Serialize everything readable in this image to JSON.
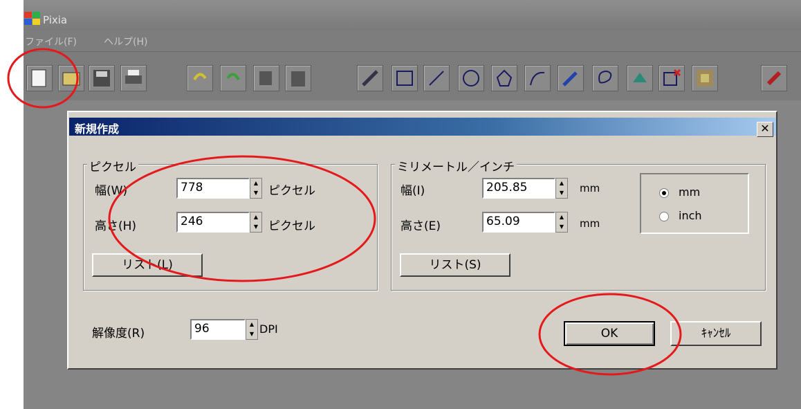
{
  "app": {
    "title": "Pixia",
    "menu": [
      "ファイル(F)",
      "ヘルプ(H)"
    ],
    "toolbar_icons": [
      "new-file-icon",
      "open-icon",
      "save-icon",
      "print-icon",
      "undo-icon",
      "redo-icon",
      "copy-icon",
      "paste-icon",
      "pen-icon",
      "rectangle-icon",
      "line-icon",
      "ellipse-icon",
      "polygon-icon",
      "curve-icon",
      "spray-icon",
      "lasso-icon",
      "fill-icon",
      "cross-select-icon",
      "pattern-icon",
      "brush-icon"
    ]
  },
  "dialog": {
    "title": "新規作成",
    "close_label": "✕",
    "pixel_group": {
      "label": "ピクセル",
      "width_label": "幅(W)",
      "width_value": "778",
      "width_unit": "ピクセル",
      "height_label": "高さ(H)",
      "height_value": "246",
      "height_unit": "ピクセル",
      "list_button": "リスト(L)"
    },
    "metric_group": {
      "label": "ミリメートル／インチ",
      "width_label": "幅(I)",
      "width_value": "205.85",
      "width_unit": "mm",
      "height_label": "高さ(E)",
      "height_value": "65.09",
      "height_unit": "mm",
      "list_button": "リスト(S)",
      "unit_options": [
        "mm",
        "inch"
      ],
      "unit_selected": "mm"
    },
    "resolution_label": "解像度(R)",
    "resolution_value": "96",
    "resolution_unit": "DPI",
    "ok_button": "OK",
    "cancel_button": "ｷｬﾝｾﾙ"
  },
  "colors": {
    "annotation": "#e4191b",
    "title_bar_start": "#0a246a",
    "dialog_bg": "#d4d0c8"
  }
}
